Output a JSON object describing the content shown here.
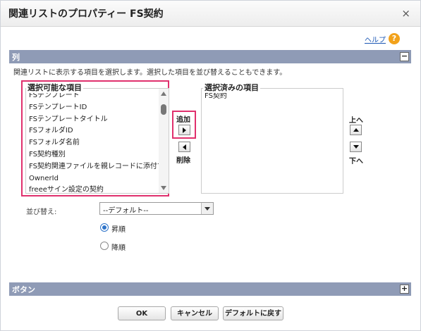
{
  "dialog": {
    "title": "関連リストのプロパティー FS契約",
    "close": "×"
  },
  "help": {
    "label": "ヘルプ",
    "icon": "?"
  },
  "columns_section": {
    "label": "列",
    "toggle": "−",
    "description": "関連リストに表示する項目を選択します。選択した項目を並び替えることもできます。"
  },
  "available": {
    "title": "選択可能な項目",
    "items": [
      "FSテンプレート",
      "FSテンプレートID",
      "FSテンプレートタイトル",
      "FSフォルダID",
      "FSフォルダ名前",
      "FS契約種別",
      "FS契約関連ファイルを親レコードに添付する",
      "OwnerId",
      "freeeサイン設定の契約"
    ]
  },
  "selected": {
    "title": "選択済みの項目",
    "items": [
      "FS契約"
    ]
  },
  "move": {
    "add_label": "追加",
    "remove_label": "削除"
  },
  "order": {
    "up_label": "上へ",
    "down_label": "下へ"
  },
  "sort": {
    "label": "並び替え:",
    "value": "--デフォルト--",
    "ascending_label": "昇順",
    "descending_label": "降順",
    "selected": "ascending"
  },
  "buttons_section": {
    "label": "ボタン",
    "toggle": "+"
  },
  "actions": {
    "ok": "OK",
    "cancel": "キャンセル",
    "default": "デフォルトに戻す"
  },
  "colors": {
    "section_bar": "#8f9bb6",
    "highlight": "#e0306d",
    "link": "#1a56b4",
    "help_icon": "#f2a21b",
    "radio_accent": "#2e74c9"
  }
}
